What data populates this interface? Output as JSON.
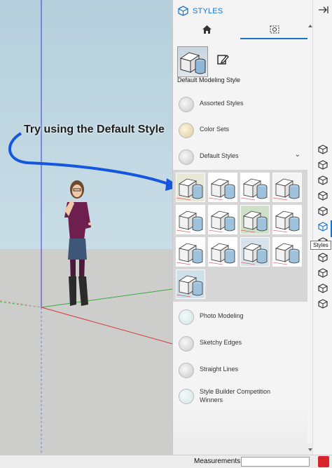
{
  "panel": {
    "title": "STYLES",
    "current_style_name": "Default Modeling Style",
    "tabs": [
      {
        "name": "home",
        "icon": "home-icon"
      },
      {
        "name": "browse",
        "icon": "select-icon"
      }
    ]
  },
  "callout": {
    "text": "Try using the Default Style"
  },
  "collections": [
    {
      "label": "Assorted Styles"
    },
    {
      "label": "Color Sets"
    },
    {
      "label": "Default Styles",
      "expanded": true
    }
  ],
  "collections_below": [
    {
      "label": "Photo Modeling"
    },
    {
      "label": "Sketchy Edges"
    },
    {
      "label": "Straight Lines"
    },
    {
      "label": "Style Builder Competition Winners"
    }
  ],
  "default_styles_thumbnails": 13,
  "tooltip": {
    "text": "Styles"
  },
  "status": {
    "measurements_label": "Measurements",
    "measurements_value": ""
  },
  "tray_icons": [
    "entity-info-icon",
    "outliner-icon",
    "instructor-icon",
    "components-icon",
    "materials-icon",
    "styles-icon",
    "scenes-icon",
    "shadows-icon",
    "fog-icon",
    "match-photo-icon",
    "soften-edges-icon"
  ],
  "colors": {
    "accent": "#1a73c9",
    "axis_red": "#d63a3a",
    "axis_green": "#3aa83a",
    "axis_blue": "#3a3ad6"
  }
}
